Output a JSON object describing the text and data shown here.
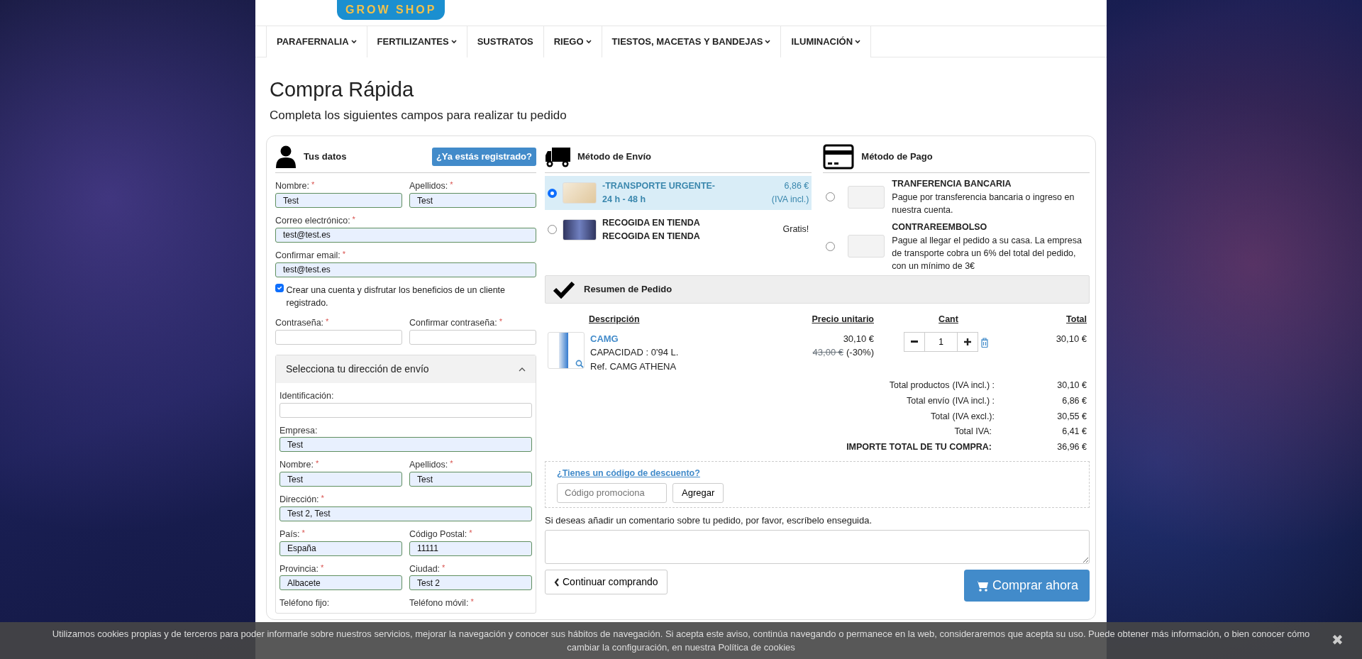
{
  "logo": {
    "text": "GROW SHOP"
  },
  "nav": [
    {
      "label": "PARAFERNALIA",
      "dropdown": true
    },
    {
      "label": "FERTILIZANTES",
      "dropdown": true
    },
    {
      "label": "SUSTRATOS",
      "dropdown": false
    },
    {
      "label": "RIEGO",
      "dropdown": true
    },
    {
      "label": "TIESTOS, MACETAS Y BANDEJAS",
      "dropdown": true
    },
    {
      "label": "ILUMINACIÓN",
      "dropdown": true
    }
  ],
  "page": {
    "title": "Compra Rápida",
    "subtitle": "Completa los siguientes campos para realizar tu pedido"
  },
  "customer": {
    "heading": "Tus datos",
    "login_button": "¿Ya estás registrado?",
    "rows": [
      [
        {
          "kind": "input",
          "label": "Nombre:",
          "required_mark": "*",
          "value": "Test"
        },
        {
          "kind": "input",
          "label": "Apellidos:",
          "required_mark": "*",
          "value": "Test"
        }
      ],
      [
        {
          "kind": "input",
          "label": "Correo electrónico:",
          "required_mark": "*",
          "value": "test@test.es"
        }
      ],
      [
        {
          "kind": "input",
          "label": "Confirmar email:",
          "required_mark": "*",
          "value": "test@test.es"
        }
      ]
    ],
    "create_account": {
      "label": "Crear una cuenta y disfrutar los beneficios de un cliente registrado.",
      "checked": true
    },
    "password_rows": [
      [
        {
          "kind": "input",
          "label": "Contraseña:",
          "required_mark": "*"
        },
        {
          "kind": "input",
          "label": "Confirmar contraseña:",
          "required_mark": "*"
        }
      ]
    ]
  },
  "address": {
    "heading": "Selecciona tu dirección de envío",
    "expanded": true,
    "rows": [
      [
        {
          "kind": "input",
          "label": "Identificación:"
        }
      ],
      [
        {
          "kind": "input",
          "label": "Empresa:",
          "value": "Test"
        }
      ],
      [
        {
          "kind": "input",
          "label": "Nombre:",
          "required_mark": "*",
          "value": "Test"
        },
        {
          "kind": "input",
          "label": "Apellidos:",
          "required_mark": "*",
          "value": "Test"
        }
      ],
      [
        {
          "kind": "input",
          "label": "Dirección:",
          "required_mark": "*",
          "value": "Test 2, Test"
        }
      ],
      [
        {
          "kind": "select",
          "label": "País:",
          "required_mark": "*",
          "value": "España"
        },
        {
          "kind": "input",
          "label": "Código Postal:",
          "required_mark": "*",
          "value": "11111"
        }
      ],
      [
        {
          "kind": "select",
          "label": "Provincia:",
          "required_mark": "*",
          "value": "Albacete"
        },
        {
          "kind": "input",
          "label": "Ciudad:",
          "required_mark": "*",
          "value": "Test 2"
        }
      ],
      [
        {
          "kind": "label",
          "label": "Teléfono fijo:"
        },
        {
          "kind": "label",
          "label": "Teléfono móvil:",
          "required_mark": "*"
        }
      ]
    ]
  },
  "shipping": {
    "heading": "Método de Envío",
    "options": [
      {
        "name": "-TRANSPORTE URGENTE-",
        "detail": "24 h - 48 h",
        "price": "6,86 €",
        "price_note": "(IVA incl.)",
        "selected": true
      },
      {
        "name": "RECOGIDA EN TIENDA",
        "detail": "RECOGIDA EN TIENDA",
        "price": "Gratis!",
        "selected": false
      }
    ]
  },
  "payment": {
    "heading": "Método de Pago",
    "options": [
      {
        "name": "TRANFERENCIA BANCARIA",
        "description": "Pague por transferencia bancaria o ingreso en nuestra cuenta.",
        "selected": false
      },
      {
        "name": "CONTRAREEMBOLSO",
        "description": "Pague al llegar el pedido a su casa. La empresa de transporte cobra un 6% del total del pedido, con un mínimo de 3€",
        "selected": false
      }
    ]
  },
  "summary": {
    "heading": "Resumen de Pedido",
    "columns": [
      "Descripción",
      "Precio unitario",
      "Cant",
      "Total"
    ],
    "items": [
      {
        "name": "CAMG",
        "lines": [
          "CAPACIDAD : 0'94 L.",
          "Ref. CAMG ATHENA"
        ],
        "price": "30,10 €",
        "old_price": "43,00 €",
        "discount": "(-30%)",
        "quantity": "1",
        "total": "30,10 €"
      }
    ],
    "totals": [
      {
        "kind": "normal",
        "label": "Total productos",
        "note": "(IVA incl.) :",
        "value": "30,10 €"
      },
      {
        "kind": "normal",
        "label": "Total envío",
        "note": "(IVA incl.) :",
        "value": "6,86 €"
      },
      {
        "kind": "normal",
        "label": "Total",
        "note": "(IVA excl.):",
        "value": "30,55 €"
      },
      {
        "kind": "normal",
        "label": "Total IVA:",
        "value": "6,41 €"
      },
      {
        "kind": "grand",
        "label": "IMPORTE TOTAL DE TU COMPRA:",
        "value": "36,96 €"
      }
    ]
  },
  "discount": {
    "link": "¿Tienes un código de descuento?",
    "placeholder": "Código promociona",
    "button": "Agregar"
  },
  "comment": {
    "label": "Si deseas añadir un comentario sobre tu pedido, por favor, escríbelo enseguida."
  },
  "actions": {
    "back": "Continuar comprando",
    "buy": "Comprar ahora"
  },
  "cookie_bar": {
    "text": "Utilizamos cookies propias y de terceros para poder informarle sobre nuestros servicios, mejorar la navegación y conocer sus hábitos de navegación. Si acepta este aviso, continúa navegando o permanece en la web, consideraremos que acepta su uso. Puede obtener más información, o bien conocer cómo cambiar la configuración, en nuestra Política de cookies",
    "close": "✖"
  }
}
